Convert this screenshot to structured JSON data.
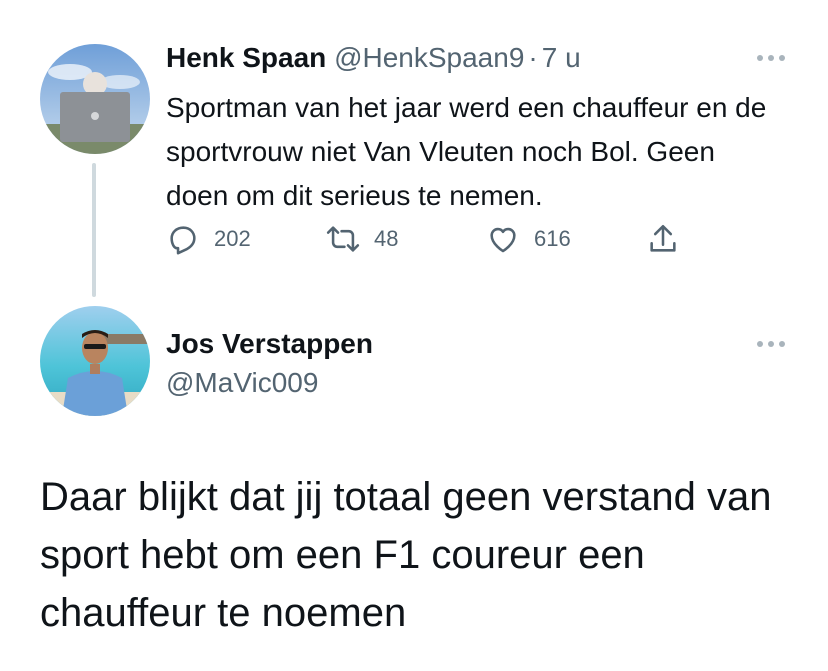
{
  "tweet1": {
    "name": "Henk Spaan",
    "handle": "@HenkSpaan9",
    "separator": "·",
    "time": "7 u",
    "text": "Sportman van het jaar werd een chauffeur en de sportvrouw niet Van Vleuten noch Bol. Geen doen om dit serieus te nemen.",
    "actions": {
      "replies": "202",
      "retweets": "48",
      "likes": "616"
    }
  },
  "tweet2": {
    "name": "Jos Verstappen",
    "handle": "@MaVic009",
    "text": "Daar blijkt dat jij totaal geen verstand van sport hebt om een F1 coureur een chauffeur te noemen"
  },
  "icons": {
    "reply": "reply-icon",
    "retweet": "retweet-icon",
    "like": "heart-icon",
    "share": "share-icon",
    "more": "more-icon"
  },
  "colors": {
    "text": "#0f1419",
    "secondary": "#536471",
    "line": "#cfd9de"
  }
}
